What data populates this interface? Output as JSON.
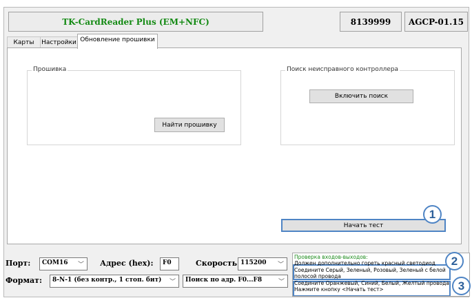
{
  "header": {
    "app_title": "TK-CardReader Plus (EM+NFC)",
    "serial": "8139999",
    "firmware_version": "AGCP-01.15"
  },
  "tabs": [
    {
      "label": "Карты",
      "active": false
    },
    {
      "label": "Настройки",
      "active": false
    },
    {
      "label": "Обновление прошивки",
      "active": true
    }
  ],
  "firmware_group": {
    "title": "Прошивка",
    "find_button": "Найти прошивку"
  },
  "search_group": {
    "title": "Поиск неисправного контроллера",
    "enable_button": "Включить поиск"
  },
  "start_test_button": "Начать тест",
  "status": {
    "port_label": "Порт:",
    "port_value": "COM16",
    "address_label": "Адрес (hex):",
    "address_value": "F0",
    "speed_label": "Скорость:",
    "speed_value": "115200",
    "format_label": "Формат:",
    "format_value": "8-N-1 (без контр., 1 стоп. бит)",
    "search_mode_value": "Поиск по адр. F0...F8"
  },
  "log": {
    "lines": [
      {
        "text": "Проверка входов-выходов:",
        "color": "#1a8a1a"
      },
      {
        "text": "Должен дополнительно гореть красный светодиод",
        "color": "#000000"
      },
      {
        "text": "Соедините Серый, Зеленый, Розовый, Зеленый с белой",
        "color": "#000000"
      },
      {
        "text": "полосой провода",
        "color": "#000000"
      },
      {
        "text": "Соедините Оранжевый, Синий, Белый, Желтый провода",
        "color": "#000000"
      },
      {
        "text": "Нажмите кнопку <Начать тест>",
        "color": "#000000"
      }
    ]
  },
  "callouts": [
    "1",
    "2",
    "3"
  ],
  "accent_color": "#4e84c4"
}
